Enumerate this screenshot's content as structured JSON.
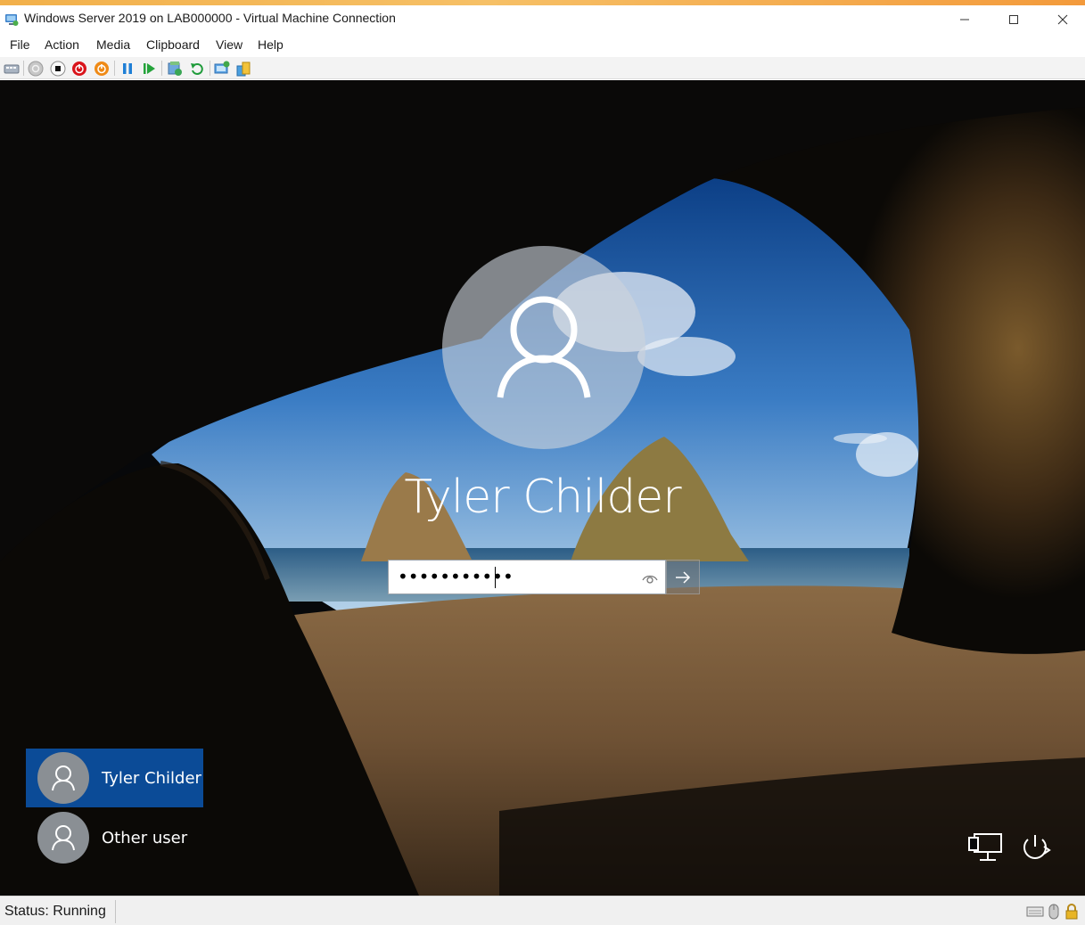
{
  "window": {
    "title": "Windows Server 2019 on LAB000000 - Virtual Machine Connection",
    "icon": "vm-connection-icon",
    "controls": [
      "minimize-icon",
      "maximize-icon",
      "close-icon"
    ]
  },
  "menu": {
    "items": [
      {
        "label": "File"
      },
      {
        "label": "Action"
      },
      {
        "label": "Media"
      },
      {
        "label": "Clipboard"
      },
      {
        "label": "View"
      },
      {
        "label": "Help"
      }
    ]
  },
  "toolbar": {
    "buttons": [
      "ctrl-alt-del-icon",
      "start-icon",
      "turn-off-icon",
      "shut-down-icon",
      "save-icon",
      "pause-icon",
      "resume-icon",
      "checkpoint-icon",
      "revert-icon",
      "enhanced-session-icon",
      "share-icon"
    ]
  },
  "login": {
    "user_name": "Tyler Childer",
    "password_value": "•••••••••••",
    "reveal_icon": "eye-icon",
    "submit_icon": "arrow-right-icon"
  },
  "users": [
    {
      "name": "Tyler Childer",
      "selected": true
    },
    {
      "name": "Other user",
      "selected": false
    }
  ],
  "corner_buttons": [
    "network-icon",
    "power-icon"
  ],
  "status": {
    "text": "Status: Running",
    "tray_icons": [
      "keyboard-icon",
      "mouse-icon",
      "lock-icon"
    ]
  },
  "colors": {
    "accent_strip": "#f2b04a",
    "selected_tile": "#0b4b97",
    "avatar_circle": "#cdd4dc"
  }
}
